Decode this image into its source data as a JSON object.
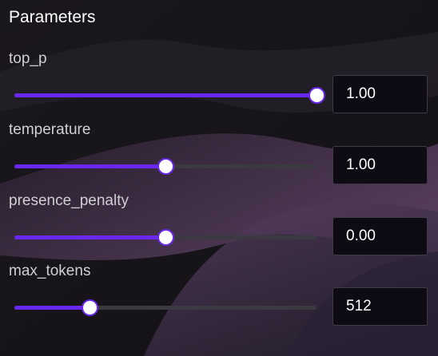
{
  "panel": {
    "title": "Parameters"
  },
  "theme": {
    "accent": "#6a27f0",
    "track": "#3a3a40"
  },
  "params": [
    {
      "label": "top_p",
      "value": "1.00",
      "level": 1.0
    },
    {
      "label": "temperature",
      "value": "1.00",
      "level": 0.5
    },
    {
      "label": "presence_penalty",
      "value": "0.00",
      "level": 0.5
    },
    {
      "label": "max_tokens",
      "value": "512",
      "level": 0.25
    }
  ]
}
